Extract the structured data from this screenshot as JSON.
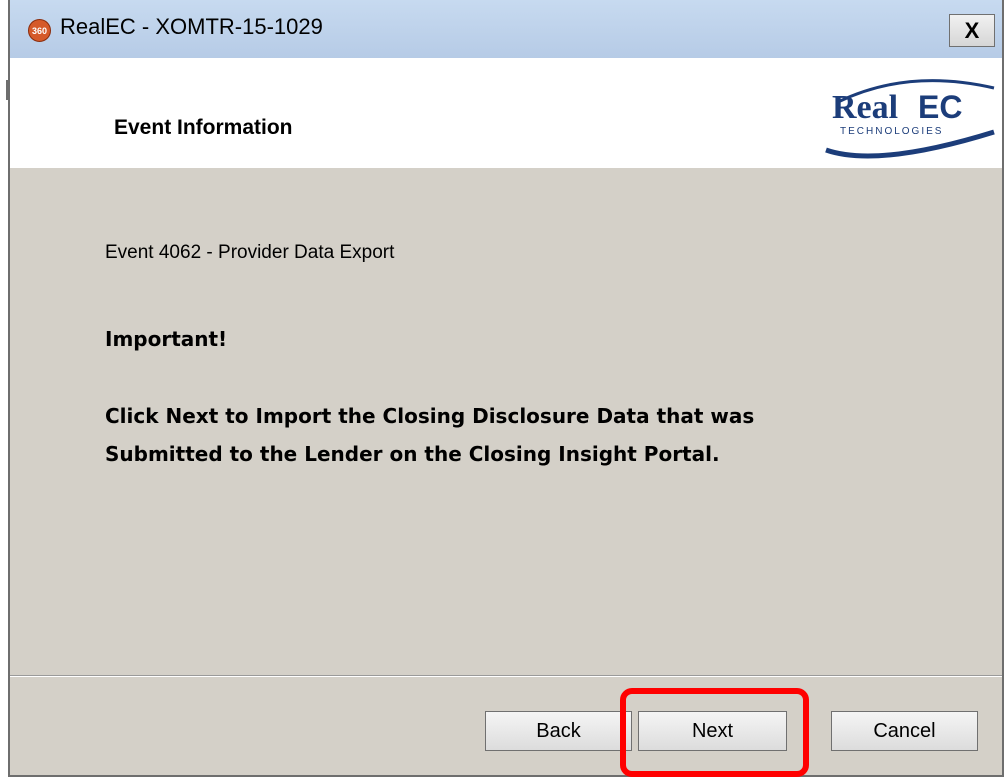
{
  "window": {
    "icon_label": "360",
    "title": "RealEC - XOMTR-15-1029",
    "close_label": "X"
  },
  "header": {
    "title": "Event Information",
    "logo_text_main": "Real",
    "logo_text_accent": "EC",
    "logo_subtext": "TECHNOLOGIES"
  },
  "content": {
    "event_line": "Event 4062 - Provider Data Export",
    "important": "Important!",
    "message": "Click Next to Import the Closing Disclosure Data that was Submitted to the Lender on the Closing Insight Portal."
  },
  "buttons": {
    "back": "Back",
    "next": "Next",
    "cancel": "Cancel"
  },
  "colors": {
    "dialog_bg": "#d4d0c8",
    "highlight": "#ff0000",
    "logo_blue": "#1c3d7a"
  }
}
